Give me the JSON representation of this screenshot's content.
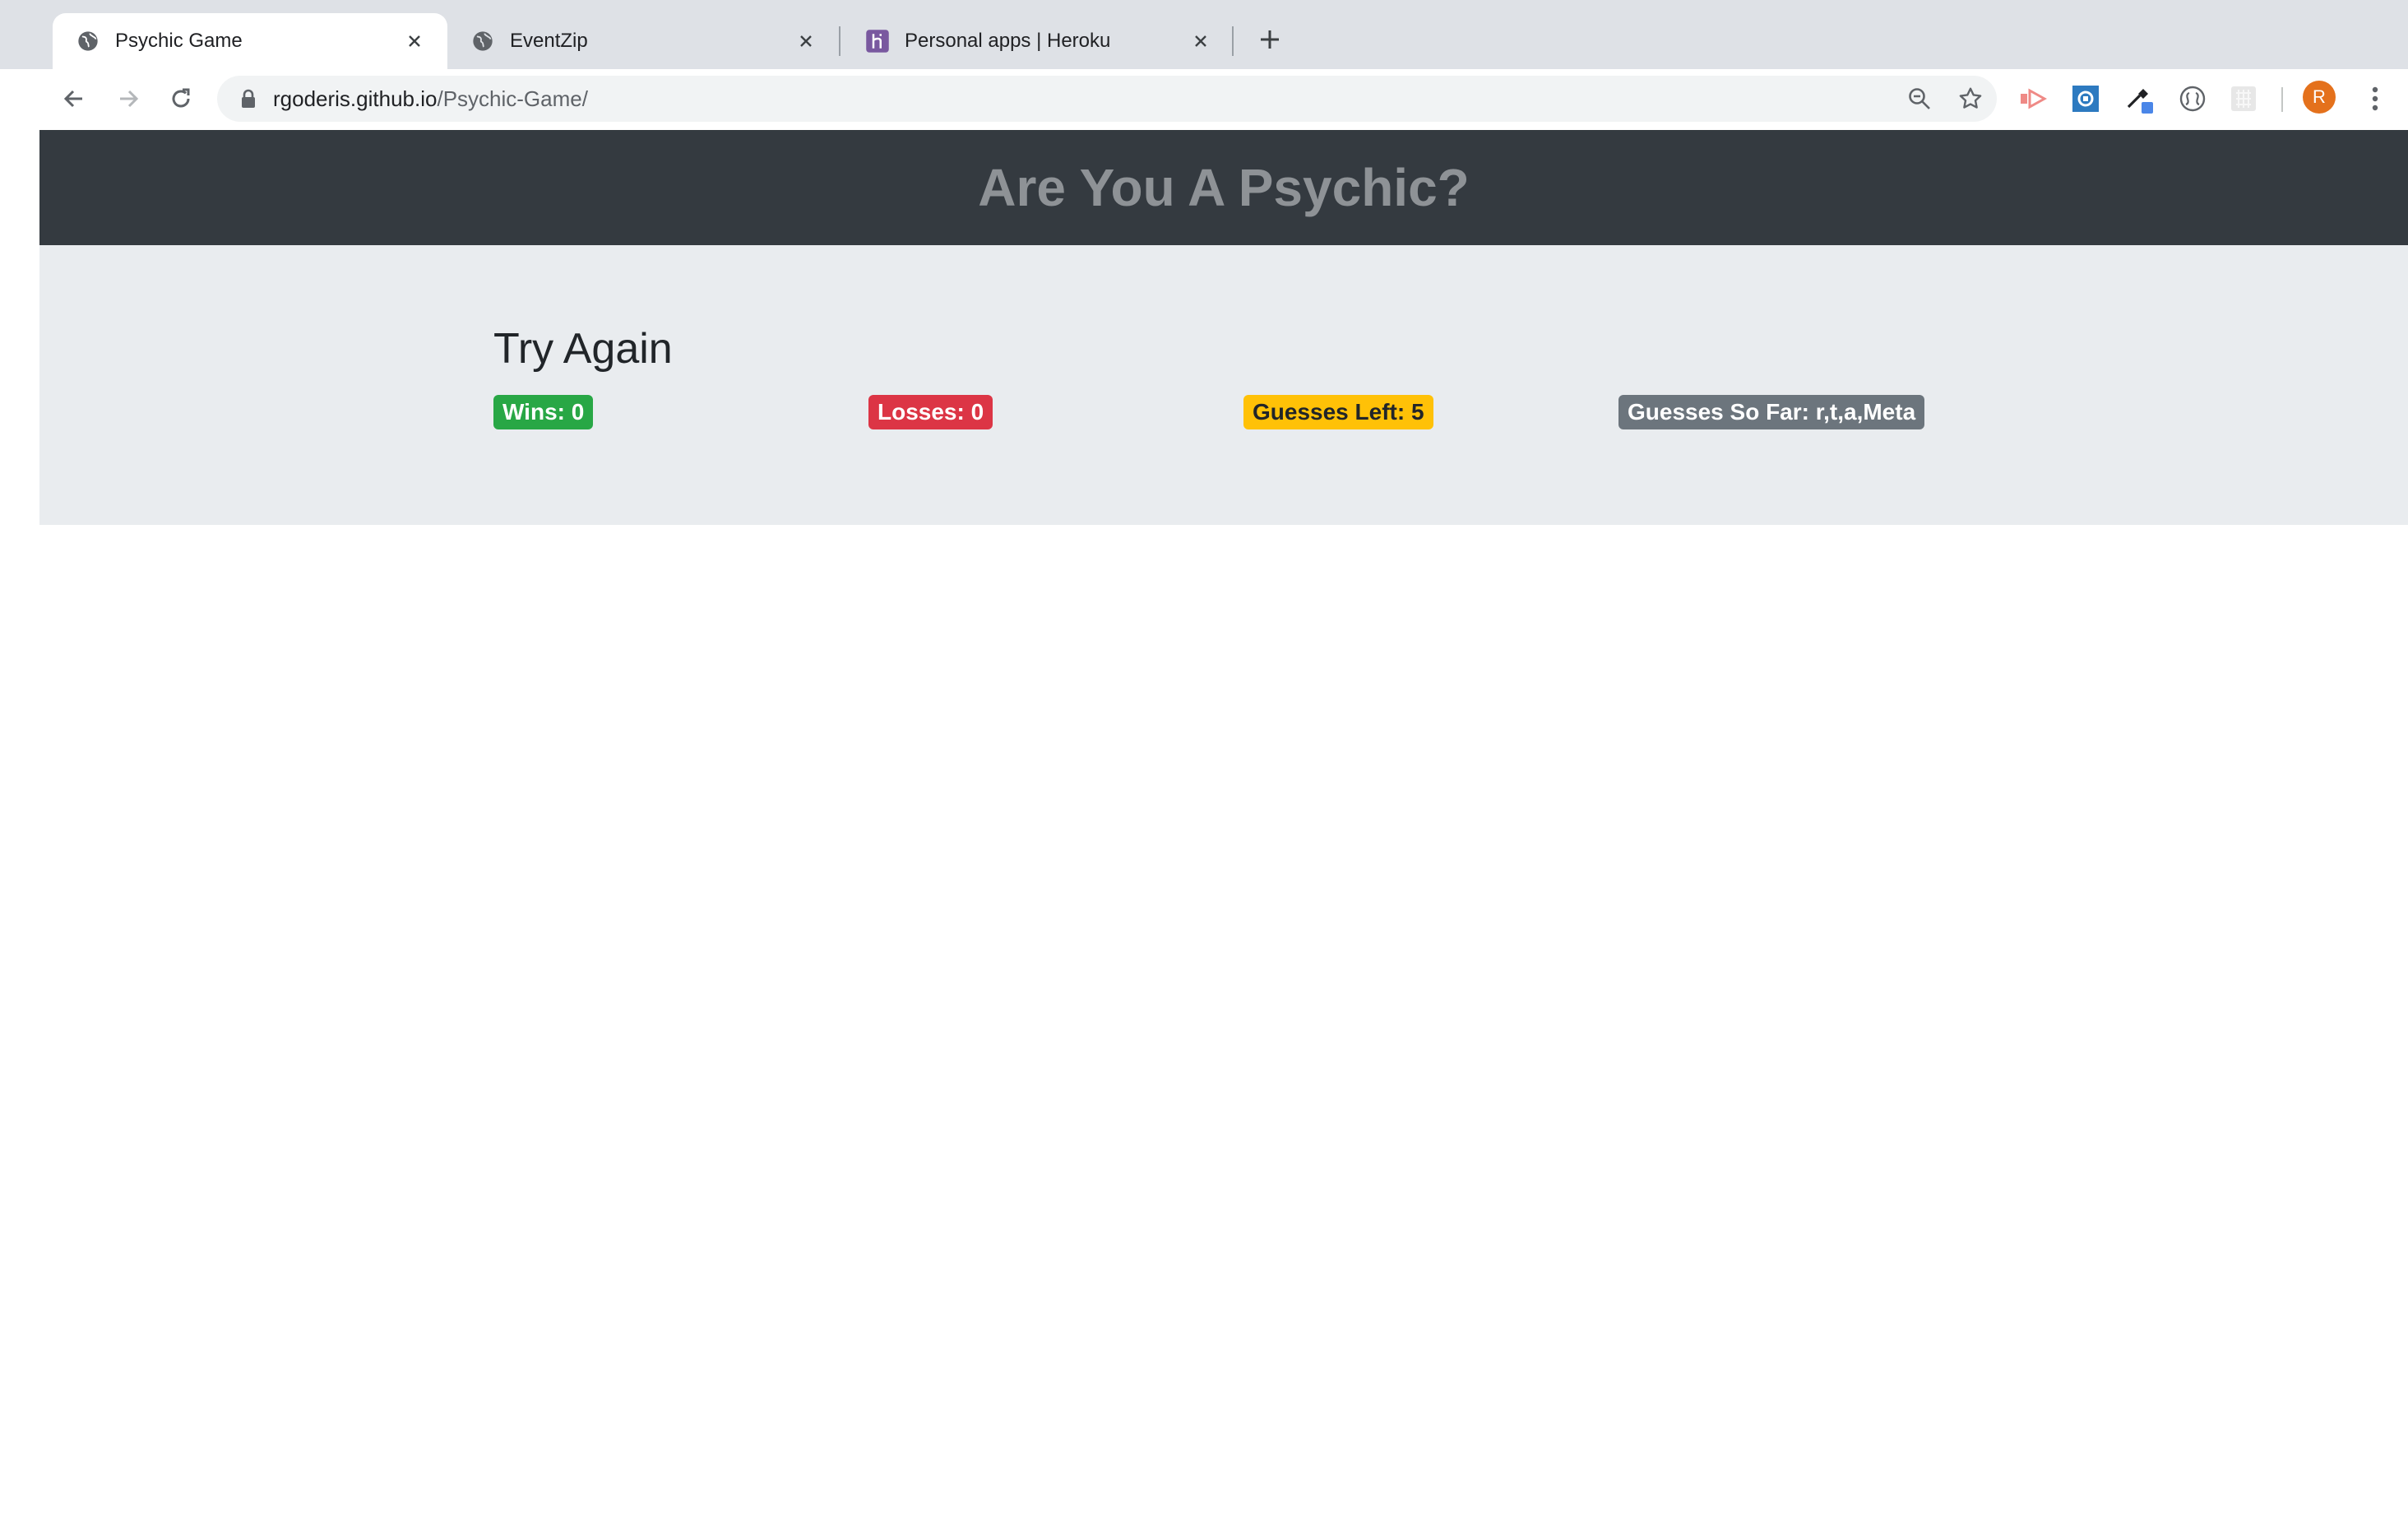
{
  "browser": {
    "tabs": [
      {
        "title": "Psychic Game",
        "favicon": "globe-icon",
        "active": true
      },
      {
        "title": "EventZip",
        "favicon": "globe-icon",
        "active": false
      },
      {
        "title": "Personal apps | Heroku",
        "favicon": "heroku-icon",
        "active": false
      }
    ],
    "address_bar": {
      "host": "rgoderis.github.io",
      "path": "/Psychic-Game/"
    },
    "profile_initial": "R"
  },
  "page": {
    "header_title": "Are You A Psychic?",
    "status_message": "Try Again",
    "stats": {
      "wins": "Wins: 0",
      "losses": "Losses: 0",
      "guesses_left": "Guesses Left: 5",
      "guesses_so_far": "Guesses So Far: r,t,a,Meta"
    }
  },
  "colors": {
    "header_bg": "#343a40",
    "jumbotron_bg": "#e9ecef",
    "wins_badge": "#28a745",
    "losses_badge": "#dc3545",
    "guesses_left_badge": "#ffc107",
    "guesses_so_far_badge": "#6c757d"
  }
}
